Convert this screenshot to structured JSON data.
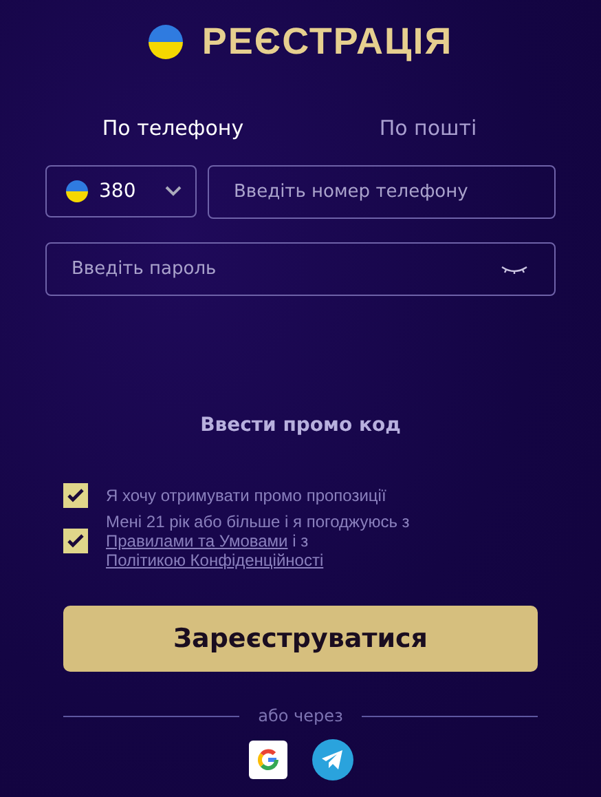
{
  "title": "РЕЄСТРАЦІЯ",
  "tabs": [
    {
      "label": "По телефону",
      "selected": true
    },
    {
      "label": "По пошті",
      "selected": false
    }
  ],
  "phone": {
    "code": "380",
    "placeholder": "Введіть номер телефону"
  },
  "password": {
    "placeholder": "Введіть пароль"
  },
  "promo_link": "Ввести промо код",
  "consents": [
    {
      "checked": true,
      "parts": [
        {
          "kind": "text",
          "text": "Я хочу отримувати промо пропозиції"
        }
      ]
    },
    {
      "checked": true,
      "parts": [
        {
          "kind": "text",
          "text": "Мені 21 рік або більше і я погоджуюсь з "
        },
        {
          "kind": "link",
          "text": "Правилами та Умовами"
        },
        {
          "kind": "text",
          "text": " і з "
        },
        {
          "kind": "link",
          "text": "Політикою Конфіденційності"
        }
      ]
    }
  ],
  "submit": "Зареєструватися",
  "divider_text": "або через"
}
